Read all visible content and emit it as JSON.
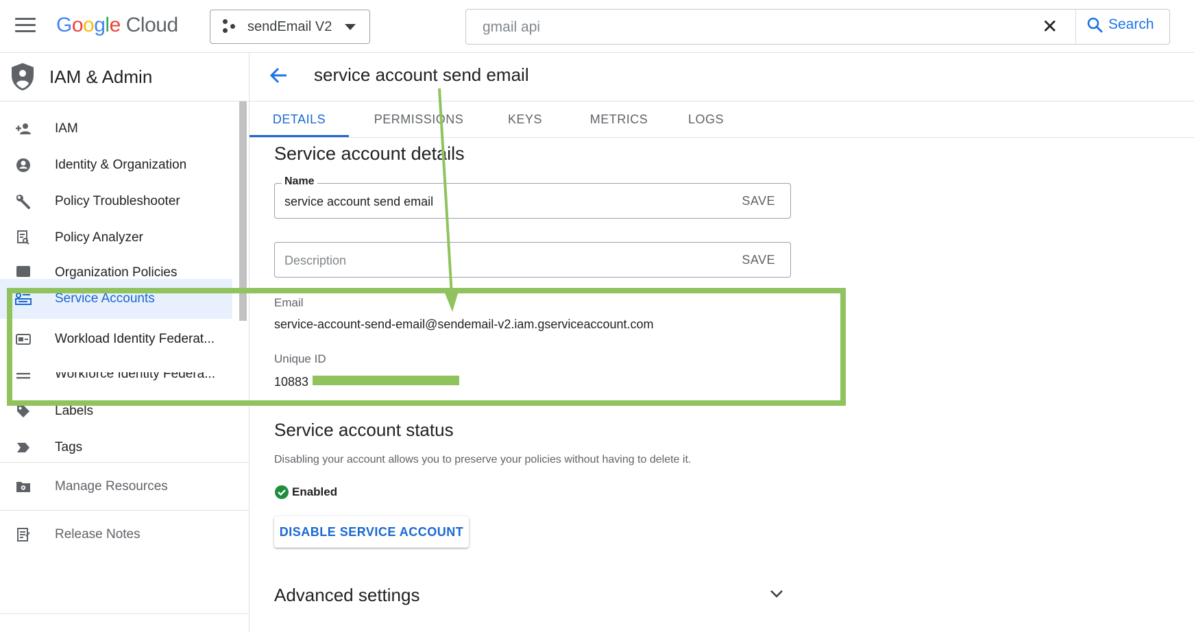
{
  "topbar": {
    "logo_letters": [
      "G",
      "o",
      "o",
      "g",
      "l",
      "e"
    ],
    "logo_product": "Cloud",
    "project_name": "sendEmail V2",
    "search_value": "gmail api",
    "search_clear": "✕",
    "search_button": "Search"
  },
  "sidebar": {
    "title": "IAM & Admin",
    "items": [
      {
        "label": "IAM",
        "icon": "person-add-icon"
      },
      {
        "label": "Identity & Organization",
        "icon": "account-circle-icon"
      },
      {
        "label": "Policy Troubleshooter",
        "icon": "wrench-icon"
      },
      {
        "label": "Policy Analyzer",
        "icon": "document-search-icon"
      },
      {
        "label": "Organization Policies",
        "icon": "policy-list-icon"
      },
      {
        "label": "Service Accounts",
        "icon": "service-account-icon"
      },
      {
        "label": "Workload Identity Federat...",
        "icon": "id-card-icon"
      },
      {
        "label": "Workforce Identity Federa...",
        "icon": "list-icon"
      },
      {
        "label": "Labels",
        "icon": "label-tag-icon"
      },
      {
        "label": "Tags",
        "icon": "tag-arrow-icon"
      },
      {
        "label": "Manage Resources",
        "icon": "folder-gear-icon"
      },
      {
        "label": "Release Notes",
        "icon": "notes-icon"
      }
    ]
  },
  "page": {
    "title": "service account send email",
    "tabs": [
      "DETAILS",
      "PERMISSIONS",
      "KEYS",
      "METRICS",
      "LOGS"
    ],
    "details_heading": "Service account details",
    "name_label": "Name",
    "name_value": "service account send email",
    "save_label": "SAVE",
    "description_placeholder": "Description",
    "email_label": "Email",
    "email_value": "service-account-send-email@sendemail-v2.iam.gserviceaccount.com",
    "unique_id_label": "Unique ID",
    "unique_id_value": "10883",
    "status_heading": "Service account status",
    "status_description": "Disabling your account allows you to preserve your policies without having to delete it.",
    "status_value": "Enabled",
    "disable_button": "DISABLE SERVICE ACCOUNT",
    "advanced_heading": "Advanced settings"
  },
  "colors": {
    "accent": "#1967d2",
    "annotation": "#90c35d",
    "success": "#1e8e3e"
  }
}
